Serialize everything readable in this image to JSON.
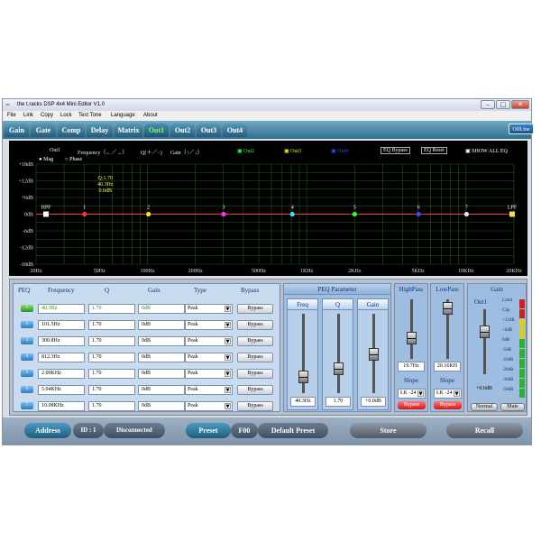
{
  "window": {
    "title": "the t.racks DSP 4x4 Mini Editor V1.0",
    "min": "–",
    "max": "□",
    "close": "✕"
  },
  "menu": [
    "File",
    "Link",
    "Copy",
    "Lock",
    "Test Tone",
    "Language",
    "About"
  ],
  "tabs": [
    "Gain",
    "Gate",
    "Comp",
    "Delay",
    "Matrix",
    "Out1",
    "Out2",
    "Out3",
    "Out4"
  ],
  "active_tab": "Out1",
  "offline_label": "OffLine",
  "graph": {
    "header_out": "Out1",
    "header_freq": "Frequency（←／→）",
    "header_q": "Q(＋／−)",
    "header_gain": "Gain（↑／↓）",
    "out2": "Out2",
    "out3": "Out3",
    "out4": "Out4",
    "eq_bypass": "EQ Bypass",
    "eq_reset": "EQ Reset",
    "show_all": "SHOW ALL EQ",
    "mag": "Mag",
    "phase": "Phase",
    "tooltip": [
      "Q:1.70",
      "40.3Hz",
      "0.0dB"
    ],
    "hpf": "HPF",
    "lpf": "LPF",
    "ylabels": [
      "+18dB",
      "+12dB",
      "+6dB",
      "0dB",
      "-6dB",
      "-12dB",
      "-18dB"
    ],
    "xlabels": [
      "20Hz",
      "50Hz",
      "100Hz",
      "200Hz",
      "500Hz",
      "1KHz",
      "2KHz",
      "5KHz",
      "10KHz",
      "20KHz"
    ],
    "points": [
      {
        "label": "1",
        "freq": 40.3,
        "color": "#ff3030"
      },
      {
        "label": "2",
        "freq": 101.5,
        "color": "#f0f000"
      },
      {
        "label": "3",
        "freq": 300.8,
        "color": "#ff30ff"
      },
      {
        "label": "4",
        "freq": 812.3,
        "color": "#30e0ff"
      },
      {
        "label": "5",
        "freq": 2000,
        "color": "#30ff30"
      },
      {
        "label": "6",
        "freq": 5040,
        "color": "#3050ff"
      },
      {
        "label": "7",
        "freq": 10080,
        "color": "#e0e0ff"
      }
    ],
    "colors": {
      "out2": "#30ff30",
      "out3": "#f0f000",
      "out4": "#3050ff"
    }
  },
  "peq": {
    "headers": [
      "PEQ",
      "Frequency",
      "Q",
      "Gain",
      "Type",
      "Bypass"
    ],
    "rows": [
      {
        "num": "1",
        "freq": "40.3Hz",
        "q": "1.70",
        "gain": "0dB",
        "type": "Peak",
        "bypass": "Bypass"
      },
      {
        "num": "2",
        "freq": "101.5Hz",
        "q": "1.70",
        "gain": "0dB",
        "type": "Peak",
        "bypass": "Bypass"
      },
      {
        "num": "3",
        "freq": "300.8Hz",
        "q": "1.70",
        "gain": "0dB",
        "type": "Peak",
        "bypass": "Bypass"
      },
      {
        "num": "4",
        "freq": "812.3Hz",
        "q": "1.70",
        "gain": "0dB",
        "type": "Peak",
        "bypass": "Bypass"
      },
      {
        "num": "5",
        "freq": "2.00KHz",
        "q": "1.70",
        "gain": "0dB",
        "type": "Peak",
        "bypass": "Bypass"
      },
      {
        "num": "6",
        "freq": "5.04KHz",
        "q": "1.70",
        "gain": "0dB",
        "type": "Peak",
        "bypass": "Bypass"
      },
      {
        "num": "7",
        "freq": "10.08KHz",
        "q": "1.70",
        "gain": "0dB",
        "type": "Peak",
        "bypass": "Bypass"
      }
    ]
  },
  "peq_param": {
    "title": "PEQ Parameter",
    "freq_label": "Freq",
    "q_label": "Q",
    "gain_label": "Gain",
    "freq_val": "40.3Hz",
    "q_val": "1.70",
    "gain_val": "+0.0dB"
  },
  "highpass": {
    "title": "HighPass",
    "value": "19.7Hz",
    "slope_title": "Slope",
    "slope": "LK -24",
    "bypass": "Bypass"
  },
  "lowpass": {
    "title": "LowPass",
    "value": "20.16KH",
    "slope_title": "Slope",
    "slope": "LK -24",
    "bypass": "Bypass"
  },
  "gain_panel": {
    "title": "Gain",
    "out": "Out1",
    "value": "+0.0dB",
    "normal": "Normal",
    "mute": "Mute",
    "meter_labels": [
      "Limit",
      "Clip",
      "+12dB",
      "+6dB",
      "0dB",
      "-5dB",
      "-10dB",
      "-20dB",
      "-30dB",
      "-50dB"
    ]
  },
  "status": {
    "address": "Address",
    "id": "ID : 1",
    "connection": "Disconnected",
    "preset": "Preset",
    "preset_num": "F00",
    "preset_name": "Default Preset",
    "store": "Store",
    "recall": "Recall"
  }
}
